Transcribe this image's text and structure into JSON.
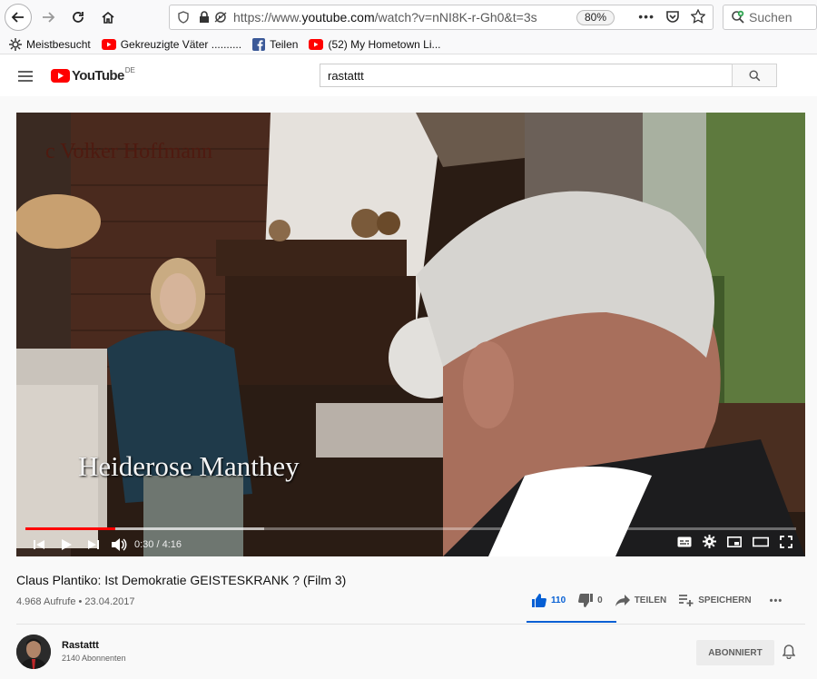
{
  "browser": {
    "url_prefix": "https://www.",
    "url_host": "youtube.com",
    "url_path": "/watch?v=nNI8K-r-Gh0&t=3s",
    "zoom": "80%",
    "search_placeholder": "Suchen",
    "bookmarks": [
      {
        "label": "Meistbesucht",
        "icon": "gear-icon"
      },
      {
        "label": "Gekreuzigte Väter ..........",
        "icon": "youtube-icon"
      },
      {
        "label": "Teilen",
        "icon": "facebook-icon"
      },
      {
        "label": "(52) My Hometown Li...",
        "icon": "youtube-icon"
      }
    ]
  },
  "youtube": {
    "logo_text": "YouTube",
    "country_code": "DE",
    "search_value": "rastattt",
    "video": {
      "overlay_name": "Heiderose Manthey",
      "watermark": "c Volker Hoffmann",
      "time_current": "0:30",
      "time_total": "4:16",
      "progress_fraction": 0.117,
      "loaded_fraction": 0.31
    },
    "title": "Claus Plantiko: Ist Demokratie GEISTESKRANK ? (Film 3)",
    "views": "4.968 Aufrufe",
    "date": "23.04.2017",
    "likes": "110",
    "dislikes": "0",
    "share_label": "TEILEN",
    "save_label": "SPEICHERN",
    "more_label": "•••",
    "channel": {
      "name": "Rastattt",
      "subscribers": "2140 Abonnenten",
      "subscribe_label": "ABONNIERT"
    }
  },
  "colors": {
    "accent": "#065fd4",
    "youtube_red": "#ff0000"
  }
}
